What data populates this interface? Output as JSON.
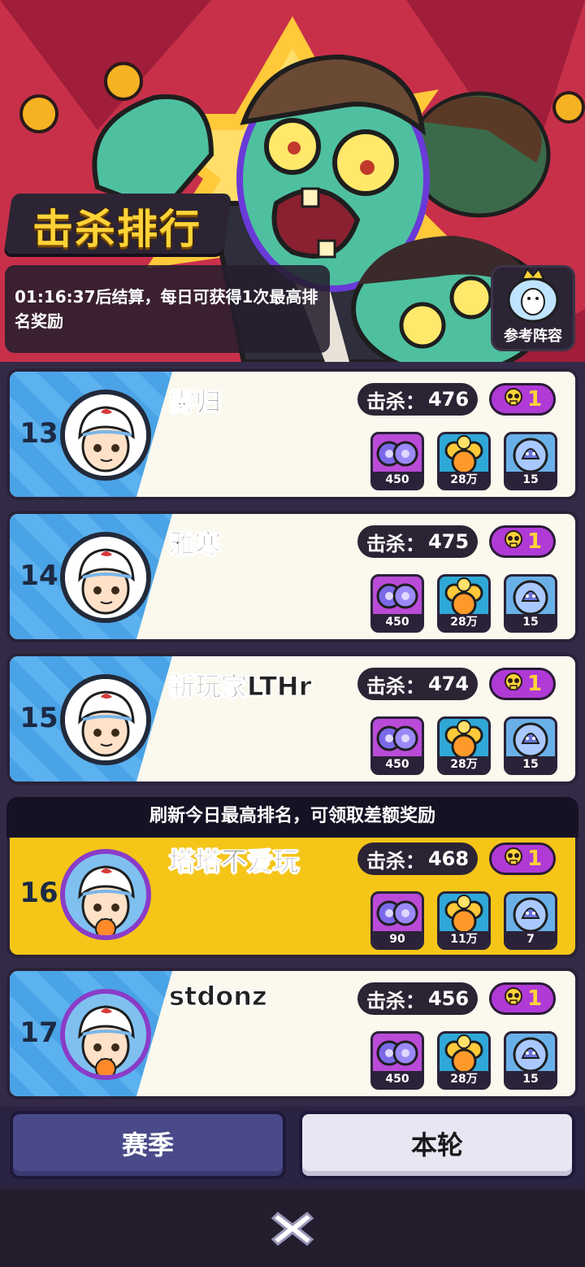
{
  "banner": {
    "title": "击杀排行",
    "notice": "01:16:37后结算，每日可获得1次最高排名奖励",
    "lineup_label": "参考阵容"
  },
  "refresh_bar_text": "刷新今日最高排名，可领取差额奖励",
  "entries": [
    {
      "rank": "13",
      "name": "雾归",
      "kills": "476",
      "badge": "1",
      "rewards": [
        "450",
        "28万",
        "15"
      ],
      "highlight": false,
      "frame": "plain"
    },
    {
      "rank": "14",
      "name": "雅寒",
      "kills": "475",
      "badge": "1",
      "rewards": [
        "450",
        "28万",
        "15"
      ],
      "highlight": false,
      "frame": "plain"
    },
    {
      "rank": "15",
      "name": "新玩家LTHr",
      "kills": "474",
      "badge": "1",
      "rewards": [
        "450",
        "28万",
        "15"
      ],
      "highlight": false,
      "frame": "plain"
    },
    {
      "rank": "16",
      "name": "塔塔不爱玩",
      "kills": "468",
      "badge": "1",
      "rewards": [
        "90",
        "11万",
        "7"
      ],
      "highlight": true,
      "frame": "purple"
    },
    {
      "rank": "17",
      "name": "stdonz",
      "kills": "456",
      "badge": "1",
      "rewards": [
        "450",
        "28万",
        "15"
      ],
      "highlight": false,
      "frame": "purple"
    }
  ],
  "kills_label": "击杀：",
  "tabs": {
    "season": "赛季",
    "round": "本轮"
  },
  "icons": {
    "reward_1": "purple-orb-gems-icon",
    "reward_2": "gold-coins-candy-icon",
    "reward_3": "blue-ghost-orb-icon",
    "badge": "skull-medal-icon",
    "close": "close-icon",
    "lineup": "ghost-crown-icon"
  },
  "colors": {
    "highlight": "#f5c518",
    "card": "#fbf8ee",
    "title": "#ffd338",
    "badge": "#b03ad6"
  }
}
